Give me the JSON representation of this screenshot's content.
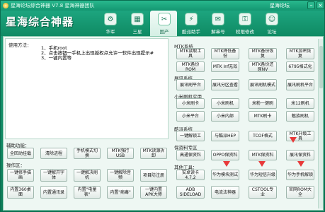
{
  "titlebar": {
    "title": "星海论坛综合神器 V7.8 星海神器团队",
    "link": "星海论坛"
  },
  "header": {
    "app_name": "星海综合神器",
    "nav": [
      {
        "label": "华军",
        "icon": "gear-icon"
      },
      {
        "label": "三星",
        "icon": "grid-icon"
      },
      {
        "label": "国产",
        "icon": "tools-icon"
      },
      {
        "label": "酷派助手",
        "icon": "bolt-icon"
      },
      {
        "label": "解串号",
        "icon": "mail-icon"
      },
      {
        "label": "权限修改",
        "icon": "key-icon"
      },
      {
        "label": "论坛",
        "icon": "people-icon"
      }
    ],
    "active_nav": 2
  },
  "usage": {
    "title": "使用方法：",
    "lines": [
      "1、手机root",
      "2、点击按钮一手机上出现授权点允许一软件出现提示#",
      "3、一键内置等"
    ]
  },
  "sections": {
    "helper": "辅助功能：",
    "operate": "操作区：",
    "mtk": "MTK系统",
    "spd": "展讯系统",
    "kujian": "小米刷机实用",
    "kupai": "酷派系统",
    "other": "其他工具：",
    "baseband": "保资料专区"
  },
  "left_buttons": [
    "全回动挂载",
    "清除进程",
    "手机模式切换",
    "MTK强行USB",
    "MTK读源拆卸",
    "一键修手描画",
    "一键解开字体",
    "一键解决刷机",
    "一键解除音频",
    "项目防注册",
    "内置360桌面",
    "内置通讯录",
    "内置\"电量表\"",
    "内置\"病毒\"",
    "一键内置APK大师"
  ],
  "right_buttons": [
    "MTK系统",
    "MTK读取工具",
    "MTK降低备份",
    "MTK备份恢复",
    "MTK加密恢复",
    "MTK备份ROM",
    "MTK Inf无效",
    "MTK备份还原NV",
    "6795格式化",
    "展讯刷平台",
    "展讯分区查看",
    "展讯刷机模式",
    "展讯刷机平台",
    "小米刷机实用",
    "小米刷卡",
    "小米刷机",
    "米粉一键刷",
    "米12刷机",
    "小米平台",
    "小米内部",
    "MTK刷卡",
    "小米刷机平台",
    "魅族刷机",
    "一键解锁工",
    "MODEM",
    "与酷派HEP",
    "TCOF格式",
    "MTK升级工具",
    "保资料专区",
    "高通保资料",
    "OPPO保资料",
    "MTK保资料",
    "展讯保资料",
    "安卓读卡4.7.2",
    "华为模块测试",
    "华为短信升级",
    "华为手机解锁",
    "ADB SIDELOAD",
    "电流法神器",
    "CSTOOL专业",
    "官网ROM大全"
  ],
  "window_buttons": {
    "minimize": "–",
    "close": "×"
  }
}
